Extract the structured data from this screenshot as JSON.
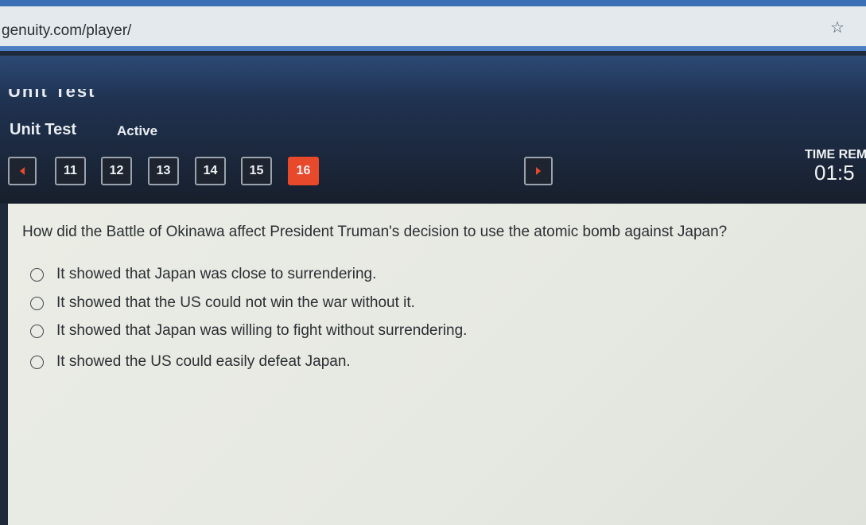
{
  "browser": {
    "url": "genuity.com/player/",
    "bookmark_icon": "star-icon"
  },
  "header": {
    "banner_title": "Unit Test",
    "title": "Unit Test",
    "status": "Active"
  },
  "navigation": {
    "prev_icon": "chevron-left-icon",
    "next_icon": "chevron-right-icon",
    "questions": [
      "11",
      "12",
      "13",
      "14",
      "15",
      "16"
    ],
    "current": "16"
  },
  "timer": {
    "label": "TIME REM",
    "value": "01:5"
  },
  "question": {
    "text": "How did the Battle of Okinawa affect President Truman's decision to use the atomic bomb against Japan?",
    "options": [
      "It showed that Japan was close to surrendering.",
      "It showed that the US could not win the war without it.",
      "It showed that Japan was willing to fight without surrendering.",
      "It showed the US could easily defeat Japan."
    ]
  },
  "colors": {
    "accent": "#e8492b",
    "header_bg": "#1f3250",
    "panel_bg": "#e6e8e2"
  }
}
